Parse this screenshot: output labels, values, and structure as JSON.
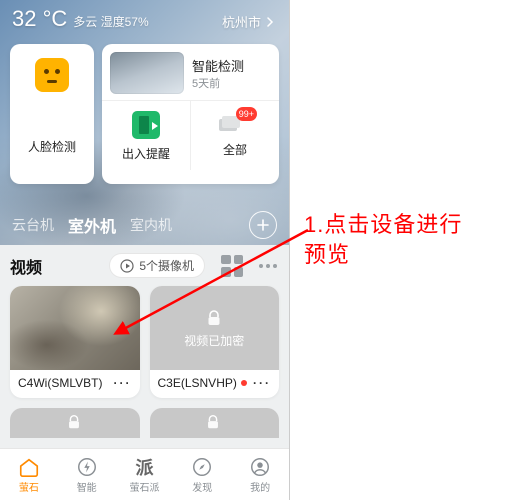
{
  "weather": {
    "temp": "32 °C",
    "desc": "多云 湿度57%",
    "city": "杭州市"
  },
  "hero_cards": {
    "face_label": "人脸检测",
    "detect_title": "智能检测",
    "detect_sub": "5天前",
    "entry_label": "出入提醒",
    "all_label": "全部",
    "all_badge": "99+"
  },
  "tabs": {
    "a": "云台机",
    "b": "室外机",
    "c": "室内机"
  },
  "section": {
    "title": "视频",
    "pill": "5个摄像机"
  },
  "cameras": [
    {
      "name": "C4Wi(SMLVBT)",
      "locked": false
    },
    {
      "name": "C3E(LSNVHP)",
      "locked": true,
      "locked_text": "视频已加密"
    }
  ],
  "nav": {
    "a": "萤石",
    "b": "智能",
    "c": "萤石派",
    "d": "发现",
    "e": "我的"
  },
  "annotation": {
    "line1": "1.点击设备进行",
    "line2": "预览"
  }
}
